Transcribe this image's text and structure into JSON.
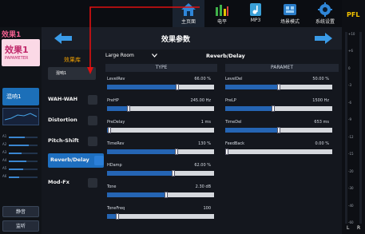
{
  "left_panel": {
    "channel_title": "效果1",
    "channel_box_label": "效果1",
    "channel_box_sub": "PAPAMETER",
    "selected_label": "混响1",
    "level_rows": [
      {
        "key": "A1",
        "fill": 0.55
      },
      {
        "key": "A2",
        "fill": 0.7
      },
      {
        "key": "A3",
        "fill": 0.45
      },
      {
        "key": "A4",
        "fill": 0.6
      },
      {
        "key": "A5",
        "fill": 0.5
      },
      {
        "key": "A6",
        "fill": 0.35
      }
    ],
    "button1": "静音",
    "button2": "监听"
  },
  "nav": {
    "home": "主页面",
    "level": "电平",
    "mp3": "MP3",
    "scene": "场景模式",
    "settings": "系统设置"
  },
  "header": {
    "title": "效果参数"
  },
  "library": {
    "label": "效果库",
    "preset": "混响1"
  },
  "effects": {
    "wah": "WAH-WAH",
    "distortion": "Distortion",
    "pitch": "Pitch-Shift",
    "reverb": "Reverb/Delay",
    "mod": "Mod-Fx"
  },
  "params": {
    "room": "Large Room",
    "effect_type": "Reverb/Delay",
    "col_type": "TYPE",
    "col_param": "PARAMET",
    "type_rows": [
      {
        "label": "LevelRev",
        "value": "66.00 %",
        "fill": 0.66
      },
      {
        "label": "PreHP",
        "value": "245.00 Hz",
        "fill": 0.2
      },
      {
        "label": "PreDelay",
        "value": "1 ms",
        "fill": 0.02
      },
      {
        "label": "TimeRev",
        "value": "130 %",
        "fill": 0.65
      },
      {
        "label": "HDamp",
        "value": "62.00 %",
        "fill": 0.62
      },
      {
        "label": "Tone",
        "value": "2.30 dB",
        "fill": 0.55
      },
      {
        "label": "ToneFreq",
        "value": "100",
        "fill": 0.1
      }
    ],
    "param_rows": [
      {
        "label": "LevelDel",
        "value": "50.00 %",
        "fill": 0.5
      },
      {
        "label": "PreLP",
        "value": "1500 Hz",
        "fill": 0.45
      },
      {
        "label": "TimeDel",
        "value": "653 ms",
        "fill": 0.5
      },
      {
        "label": "FeedBack",
        "value": "0.00 %",
        "fill": 0.0
      }
    ]
  },
  "pfl": {
    "title": "PFL",
    "scale": [
      "+10",
      "+6",
      "0",
      "-3",
      "-6",
      "-9",
      "-12",
      "-15",
      "-20",
      "-30",
      "-40",
      "-60"
    ],
    "left": "L",
    "right": "R"
  },
  "colors": {
    "accent_blue": "#1e6fc0",
    "library_orange": "#f0a000",
    "pfl_yellow": "#f5c400",
    "annotation_red": "#e01010"
  }
}
